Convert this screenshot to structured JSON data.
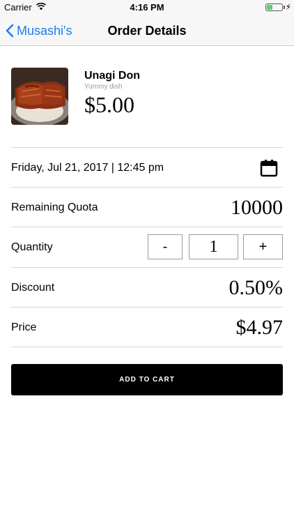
{
  "status_bar": {
    "carrier": "Carrier",
    "time": "4:16 PM",
    "battery_level": 0.4,
    "battery_color": "#4cd964",
    "icons": [
      "wifi-icon",
      "battery-icon",
      "charging-bolt-icon"
    ]
  },
  "nav": {
    "back_label": "Musashi's",
    "title": "Order Details",
    "accent_color": "#1a7cf5"
  },
  "product": {
    "name": "Unagi Don",
    "description": "Yummy dish",
    "price": "$5.00"
  },
  "order": {
    "date_time": "Friday, Jul 21, 2017 | 12:45 pm",
    "remaining_quota_label": "Remaining Quota",
    "remaining_quota_value": "10000",
    "quantity_label": "Quantity",
    "quantity_minus": "-",
    "quantity_value": "1",
    "quantity_plus": "+",
    "discount_label": "Discount",
    "discount_value": "0.50%",
    "price_label": "Price",
    "price_value": "$4.97"
  },
  "actions": {
    "add_to_cart": "ADD TO CART"
  }
}
